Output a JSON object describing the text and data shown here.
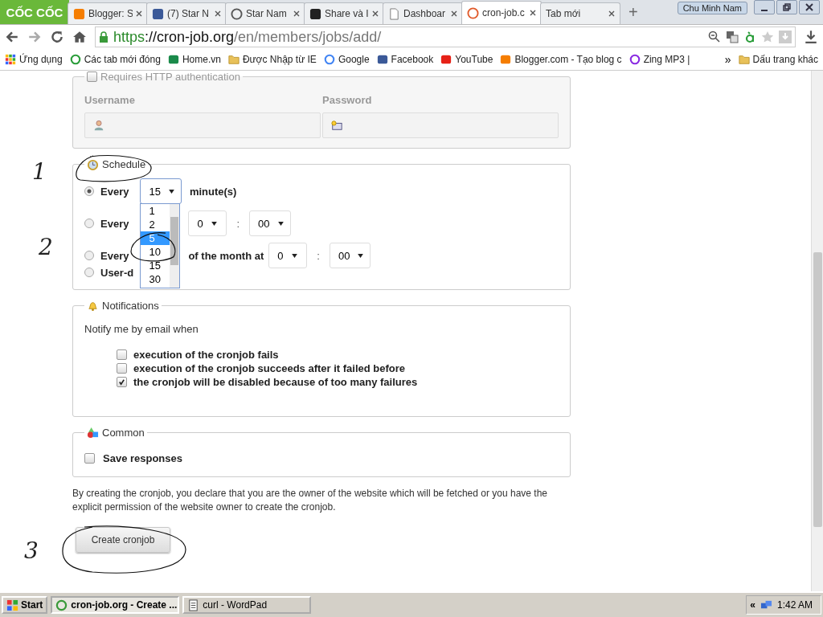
{
  "browser": {
    "logo": "CỐC CỐC",
    "tabs": [
      {
        "title": "Blogger: S",
        "selected": false
      },
      {
        "title": "(7) Star N",
        "selected": false
      },
      {
        "title": "Star Nam",
        "selected": false
      },
      {
        "title": "Share và I",
        "selected": false
      },
      {
        "title": "Dashboar",
        "selected": false
      },
      {
        "title": "cron-job.c",
        "selected": true
      },
      {
        "title": "Tab mới",
        "selected": false
      }
    ],
    "new_tab": "+",
    "user": "Chu Minh Nam",
    "url": {
      "scheme": "https",
      "host": "://cron-job.org",
      "path": "/en/members/jobs/add/"
    },
    "bookmarks": [
      {
        "label": "Ứng dụng"
      },
      {
        "label": "Các tab mới đóng"
      },
      {
        "label": "Home.vn"
      },
      {
        "label": "Được Nhập từ IE"
      },
      {
        "label": "Google"
      },
      {
        "label": "Facebook"
      },
      {
        "label": "YouTube"
      },
      {
        "label": "Blogger.com - Tạo blog c"
      },
      {
        "label": "Zing MP3 |"
      }
    ],
    "more": "»",
    "other_bookmarks": "Dấu trang khác"
  },
  "auth": {
    "legend": "Requires HTTP authentication",
    "checked": false,
    "fields": [
      {
        "label": "Username"
      },
      {
        "label": "Password"
      }
    ]
  },
  "schedule": {
    "legend": "Schedule",
    "separator": ":",
    "options": [
      {
        "kind": "minutes",
        "selected": true,
        "label": "Every",
        "value": "15",
        "unit": "minute(s)"
      },
      {
        "kind": "daily",
        "selected": false,
        "label": "Every",
        "hour": "0",
        "minute": "00"
      },
      {
        "kind": "monthly",
        "selected": false,
        "label": "Every",
        "suffix": "of the month at",
        "hour": "0",
        "minute": "00"
      },
      {
        "kind": "custom",
        "selected": false,
        "label": "User-d"
      }
    ],
    "dropdown": [
      {
        "label": "1",
        "selected": false
      },
      {
        "label": "2",
        "selected": false
      },
      {
        "label": "5",
        "selected": true
      },
      {
        "label": "10",
        "selected": false
      },
      {
        "label": "15",
        "selected": false
      },
      {
        "label": "30",
        "selected": false
      }
    ]
  },
  "notifications": {
    "legend": "Notifications",
    "intro": "Notify me by email when",
    "items": [
      {
        "label": "execution of the cronjob fails",
        "checked": false
      },
      {
        "label": "execution of the cronjob succeeds after it failed before",
        "checked": false
      },
      {
        "label": "the cronjob will be disabled because of too many failures",
        "checked": true
      }
    ]
  },
  "common": {
    "legend": "Common",
    "items": [
      {
        "label": "Save responses",
        "checked": false
      }
    ]
  },
  "disclaimer": "By creating the cronjob, you declare that you are the owner of the website which will be fetched or you have the explicit permission of the website owner to create the cronjob.",
  "submit": "Create cronjob",
  "annotations": [
    {
      "label": "1"
    },
    {
      "label": "2"
    },
    {
      "label": "3"
    }
  ],
  "taskbar": {
    "start": "Start",
    "tasks": [
      {
        "title": "cron-job.org - Create ...",
        "selected": true
      },
      {
        "title": "curl - WordPad",
        "selected": false
      }
    ],
    "tray": "«",
    "time": "1:42 AM"
  }
}
